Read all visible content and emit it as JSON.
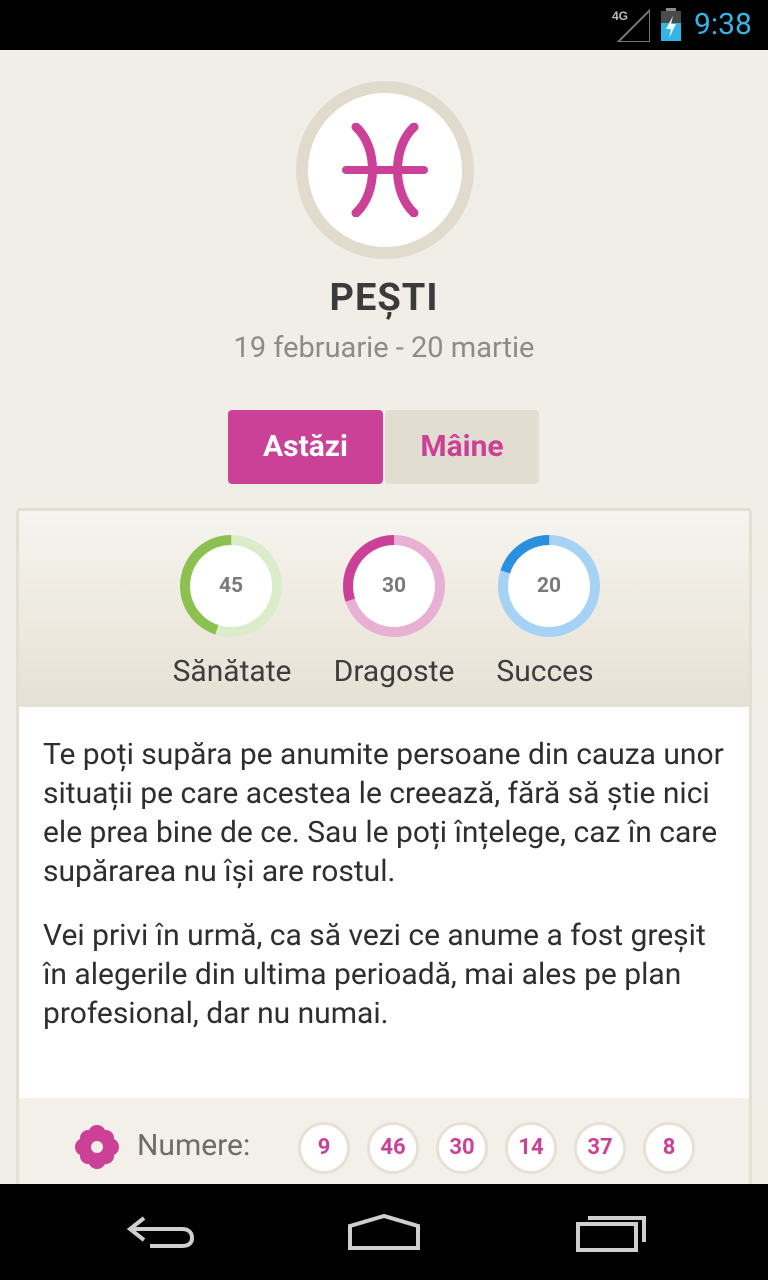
{
  "status_bar": {
    "network": "4G",
    "time": "9:38",
    "time_color": "#33b5e5"
  },
  "header": {
    "sign_name": "PEȘTI",
    "sign_dates": "19 februarie - 20 martie",
    "sign_icon": "pisces-icon"
  },
  "tabs": [
    {
      "label": "Astăzi",
      "active": true
    },
    {
      "label": "Mâine",
      "active": false
    }
  ],
  "stats": [
    {
      "label": "Sănătate",
      "value": 45,
      "percent": 45,
      "color": "#8cc152",
      "track": "#dbeccb"
    },
    {
      "label": "Dragoste",
      "value": 30,
      "percent": 30,
      "color": "#cc4198",
      "track": "#e8b0d3"
    },
    {
      "label": "Succes",
      "value": 20,
      "percent": 20,
      "color": "#2b8fe0",
      "track": "#a6d3f5"
    }
  ],
  "horoscope_text": {
    "p1": "Te poți supăra pe anumite persoane din cauza unor situații pe care acestea le creează, fără să știe nici ele prea bine de ce. Sau le poți înțelege, caz în care supărarea nu își are rostul.",
    "p2": "Vei privi în urmă, ca să vezi ce anume a fost greșit în alegerile din ultima perioadă, mai ales pe plan profesional, dar nu numai."
  },
  "lucky_numbers": {
    "label": "Numere:",
    "icon": "flower-icon",
    "values": [
      "9",
      "46",
      "30",
      "14",
      "37",
      "8"
    ]
  },
  "colors": {
    "accent": "#cc4198",
    "background": "#f1eee8"
  }
}
